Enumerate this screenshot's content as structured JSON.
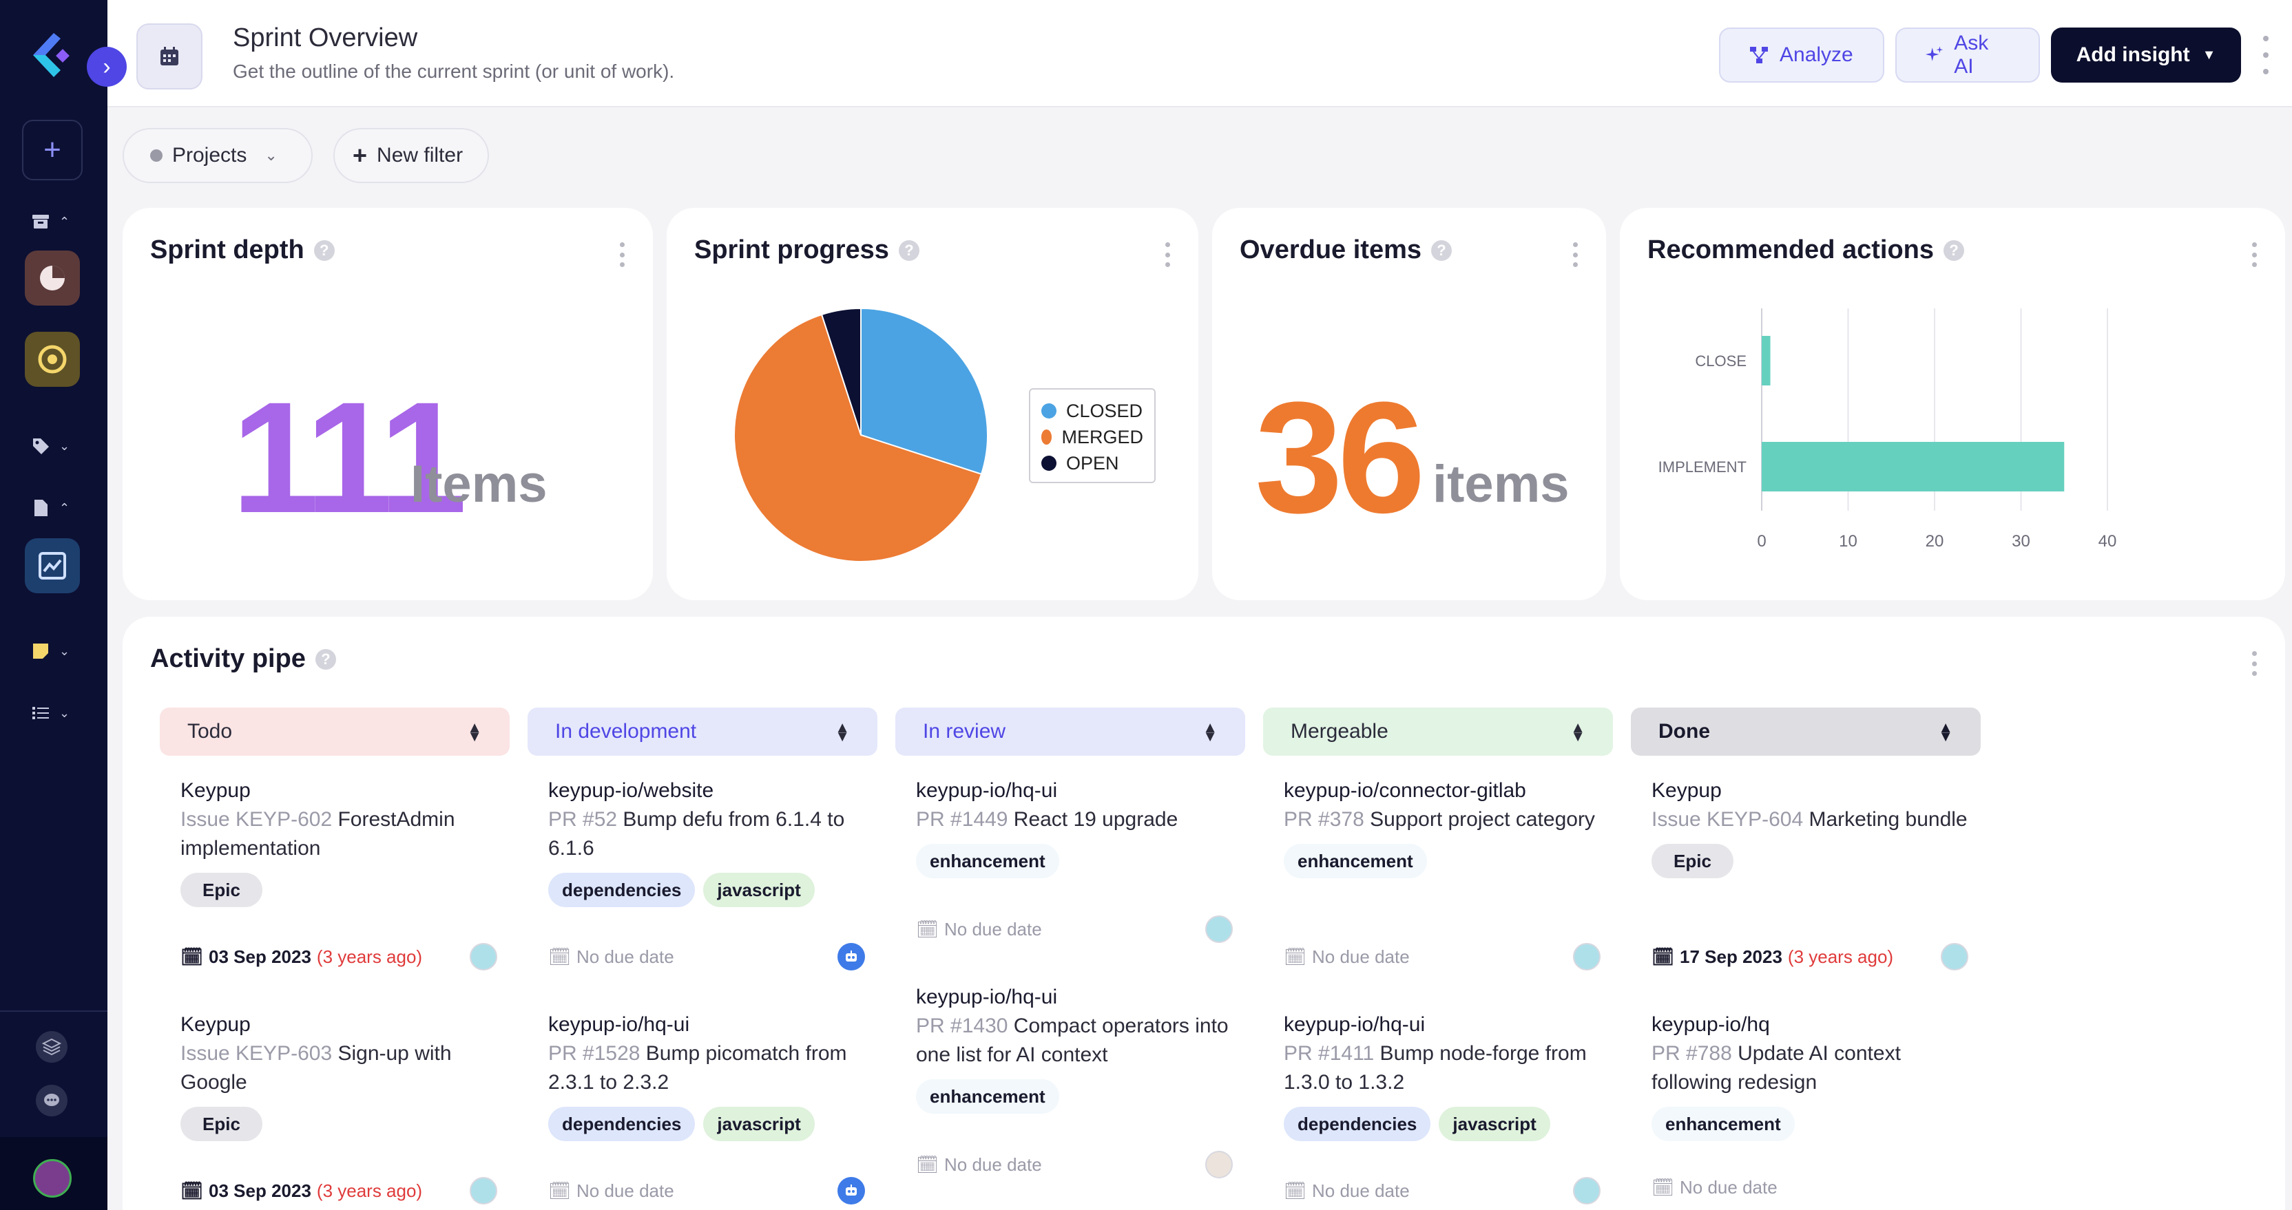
{
  "header": {
    "title": "Sprint Overview",
    "subtitle": "Get the outline of the current sprint (or unit of work).",
    "analyze_label": "Analyze",
    "ask_ai_label": "Ask AI",
    "add_insight_label": "Add insight"
  },
  "filters": {
    "projects_label": "Projects",
    "new_filter_label": "New filter"
  },
  "sprint_depth": {
    "title": "Sprint depth",
    "value": "111",
    "unit": "Items"
  },
  "sprint_progress": {
    "title": "Sprint progress",
    "legend": [
      {
        "label": "CLOSED",
        "color": "#4ba3e3"
      },
      {
        "label": "MERGED",
        "color": "#ec7b34"
      },
      {
        "label": "OPEN",
        "color": "#0c1033"
      }
    ]
  },
  "overdue": {
    "title": "Overdue items",
    "value": "36",
    "unit": "items"
  },
  "recommended": {
    "title": "Recommended actions"
  },
  "chart_data": [
    {
      "type": "pie",
      "categories": [
        "CLOSED",
        "MERGED",
        "OPEN"
      ],
      "values": [
        30,
        65,
        5
      ],
      "colors": [
        "#4ba3e3",
        "#ec7b34",
        "#0c1033"
      ],
      "legend": "right"
    },
    {
      "type": "bar",
      "orientation": "horizontal",
      "categories": [
        "CLOSE",
        "IMPLEMENT"
      ],
      "values": [
        1,
        35
      ],
      "xlim": [
        0,
        40
      ],
      "xticks": [
        0,
        10,
        20,
        30,
        40
      ],
      "grid": true,
      "color": "#66d0bf"
    }
  ],
  "activity": {
    "title": "Activity pipe",
    "columns": [
      {
        "label": "Todo",
        "bg": "#fbe4e4",
        "fg": "#2b2b3a"
      },
      {
        "label": "In development",
        "bg": "#e5e8fb",
        "fg": "#4f46e5"
      },
      {
        "label": "In review",
        "bg": "#e5e8fb",
        "fg": "#4f46e5"
      },
      {
        "label": "Mergeable",
        "bg": "#e2f4e4",
        "fg": "#2b2b3a"
      },
      {
        "label": "Done",
        "bg": "#dedee2",
        "fg": "#1a1a2e"
      }
    ],
    "items": {
      "todo1": {
        "repo": "Keypup",
        "ref": "Issue KEYP-602",
        "desc": " ForestAdmin implementation",
        "tag": "Epic",
        "date": "03 Sep 2023",
        "ago": "(3 years ago)"
      },
      "todo2": {
        "repo": "Keypup",
        "ref": "Issue KEYP-603",
        "desc": " Sign-up with Google",
        "tag": "Epic",
        "date": "03 Sep 2023",
        "ago": "(3 years ago)"
      },
      "dev1": {
        "repo": "keypup-io/website",
        "ref": "PR #52",
        "desc": " Bump defu from 6.1.4 to 6.1.6",
        "tag1": "dependencies",
        "tag2": "javascript",
        "date": "No due date"
      },
      "dev2": {
        "repo": "keypup-io/hq-ui",
        "ref": "PR #1528",
        "desc": " Bump picomatch from 2.3.1 to 2.3.2",
        "tag1": "dependencies",
        "tag2": "javascript",
        "date": "No due date"
      },
      "rev1": {
        "repo": "keypup-io/hq-ui",
        "ref": "PR #1449",
        "desc": " React 19 upgrade",
        "tag": "enhancement",
        "date": "No due date"
      },
      "rev2": {
        "repo": "keypup-io/hq-ui",
        "ref": "PR #1430",
        "desc": " Compact operators into one list for AI context",
        "tag": "enhancement",
        "date": "No due date"
      },
      "mrg1": {
        "repo": "keypup-io/connector-gitlab",
        "ref": "PR #378",
        "desc": " Support project category",
        "tag": "enhancement",
        "date": "No due date"
      },
      "mrg2": {
        "repo": "keypup-io/hq-ui",
        "ref": "PR #1411",
        "desc": " Bump node-forge from 1.3.0 to 1.3.2",
        "tag1": "dependencies",
        "tag2": "javascript",
        "date": "No due date"
      },
      "done1": {
        "repo": "Keypup",
        "ref": "Issue KEYP-604",
        "desc": " Marketing bundle",
        "tag": "Epic",
        "date": "17 Sep 2023",
        "ago": "(3 years ago)"
      },
      "done2": {
        "repo": "keypup-io/hq",
        "ref": "PR #788",
        "desc": " Update AI context following redesign",
        "tag": "enhancement",
        "date": "No due date"
      }
    }
  }
}
